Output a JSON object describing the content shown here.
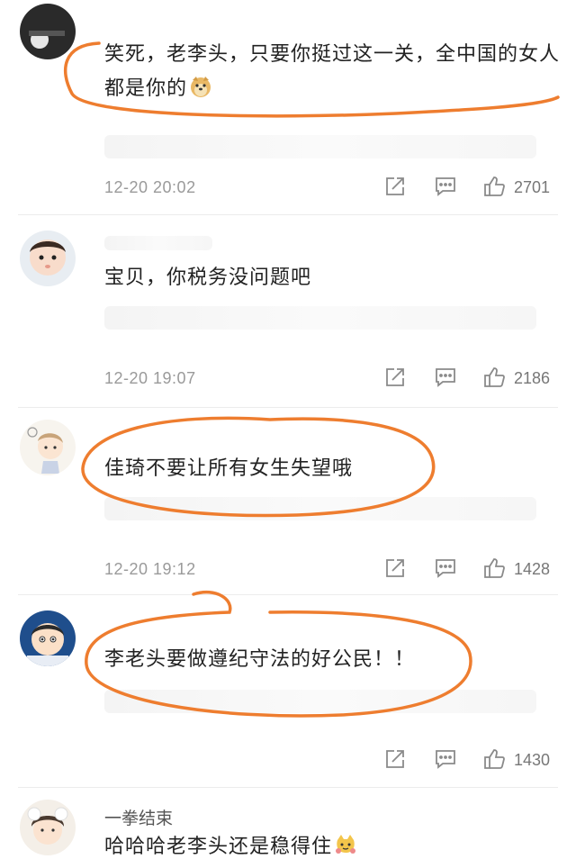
{
  "comments": [
    {
      "username": "",
      "text": "笑死，老李头，只要你挺过这一关，全中国的女人都是你的",
      "emoji": "doge-emoji",
      "time": "12-20 20:02",
      "likes": "2701"
    },
    {
      "username": "",
      "text": "宝贝，你税务没问题吧",
      "time": "12-20 19:07",
      "likes": "2186"
    },
    {
      "username": "",
      "text": "佳琦不要让所有女生失望哦",
      "time": "12-20 19:12",
      "likes": "1428"
    },
    {
      "username": "",
      "text": "李老头要做遵纪守法的好公民！！",
      "time": "",
      "likes": "1430"
    },
    {
      "username": "一拳结束",
      "text": "哈哈哈老李头还是稳得住",
      "emoji": "cat-emoji",
      "time": "",
      "likes": ""
    }
  ],
  "colors": {
    "highlight_ring": "#ee7d2f",
    "meta_text": "#9a9a9a",
    "icon_stroke": "#8a8a8a"
  }
}
